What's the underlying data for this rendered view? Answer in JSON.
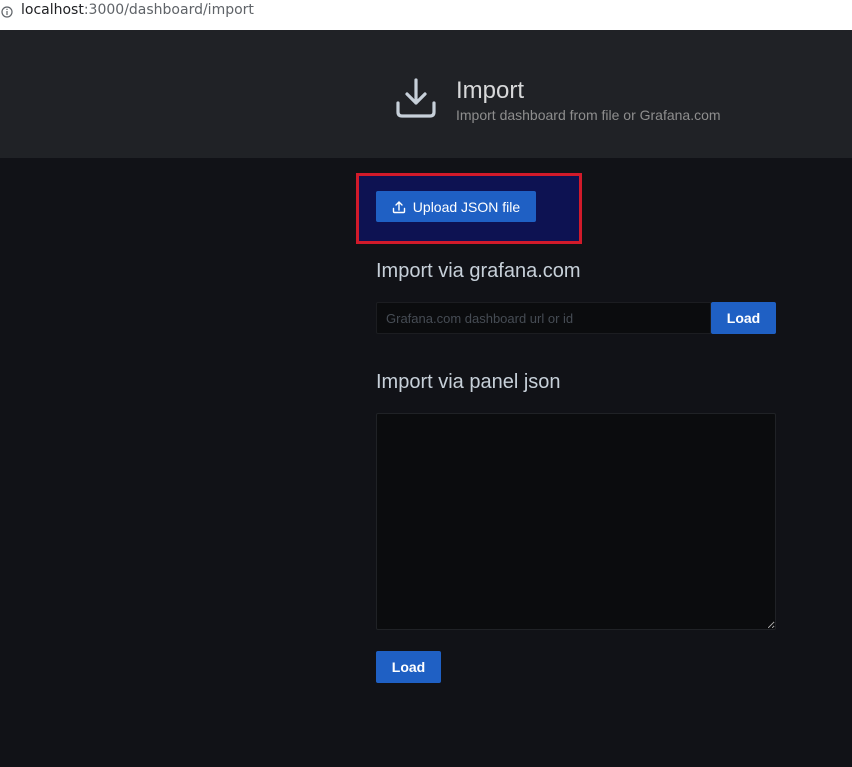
{
  "browser": {
    "url_host": "localhost",
    "url_rest": ":3000/dashboard/import",
    "info_icon": "info-icon"
  },
  "header": {
    "icon": "import-icon",
    "title": "Import",
    "subtitle": "Import dashboard from file or Grafana.com"
  },
  "upload": {
    "icon": "upload-icon",
    "label": "Upload JSON file",
    "highlight_color": "#d11a2a"
  },
  "grafana_com": {
    "heading": "Import via grafana.com",
    "input_placeholder": "Grafana.com dashboard url or id",
    "input_value": "",
    "load_label": "Load"
  },
  "panel_json": {
    "heading": "Import via panel json",
    "textarea_value": "",
    "load_label": "Load"
  },
  "colors": {
    "background": "#111217",
    "header_background": "#202226",
    "primary_button": "#1f60c4"
  }
}
